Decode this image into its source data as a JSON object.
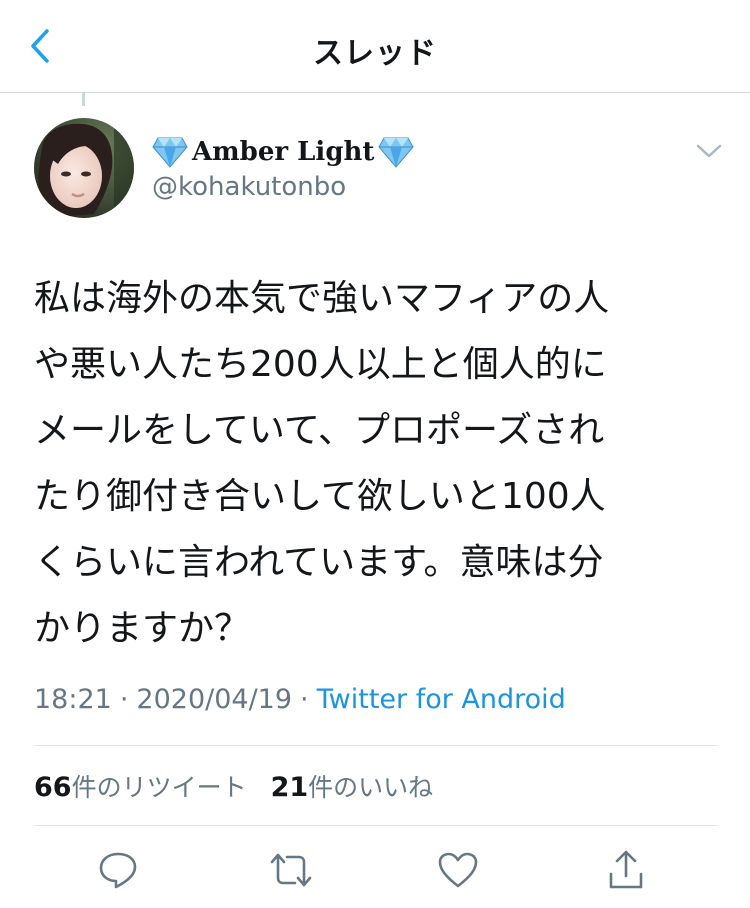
{
  "header": {
    "title": "スレッド",
    "back_icon": "chevron-left-icon"
  },
  "tweet": {
    "display_name": "Amber Light",
    "handle": "@kohakutonbo",
    "name_emoji": "diamond-icon",
    "text_lines": [
      "私は海外の本気で強いマフィアの人",
      "や悪い人たち200人以上と個人的に",
      "メールをしていて、プロポーズされ",
      "たり御付き合いして欲しいと100人",
      "くらいに言われています。意味は分",
      "かりますか？"
    ],
    "time": "18:21",
    "separator": "·",
    "date": "2020/04/19",
    "source": "Twitter for Android"
  },
  "stats": {
    "retweets_count": "66",
    "retweets_label": "件のリツイート",
    "likes_count": "21",
    "likes_label": "件のいいね"
  },
  "actions": {
    "reply_icon": "reply-icon",
    "retweet_icon": "retweet-icon",
    "like_icon": "heart-icon",
    "share_icon": "share-icon"
  },
  "colors": {
    "accent": "#1b95e0",
    "secondary_text": "#657786",
    "primary_text": "#14171a",
    "divider": "#e1e8ed"
  }
}
